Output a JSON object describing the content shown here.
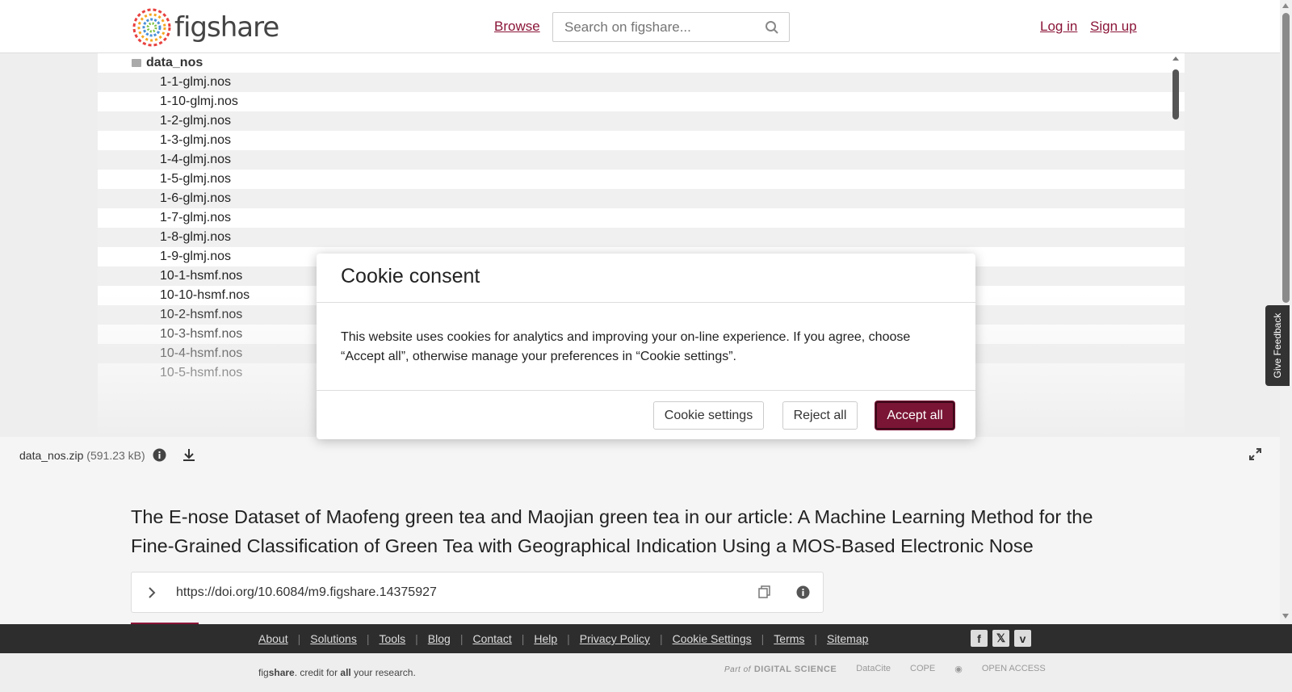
{
  "header": {
    "logo_text": "figshare",
    "browse_label": "Browse",
    "search_placeholder": "Search on figshare...",
    "login_label": "Log in",
    "signup_label": "Sign up"
  },
  "file_tree": {
    "root": "data_nos",
    "files": [
      "1-1-glmj.nos",
      "1-10-glmj.nos",
      "1-2-glmj.nos",
      "1-3-glmj.nos",
      "1-4-glmj.nos",
      "1-5-glmj.nos",
      "1-6-glmj.nos",
      "1-7-glmj.nos",
      "1-8-glmj.nos",
      "1-9-glmj.nos",
      "10-1-hsmf.nos",
      "10-10-hsmf.nos",
      "10-2-hsmf.nos",
      "10-3-hsmf.nos",
      "10-4-hsmf.nos",
      "10-5-hsmf.nos"
    ]
  },
  "file_bar": {
    "file_name": "data_nos.zip",
    "file_size": "(591.23 kB)"
  },
  "item": {
    "title": "The E-nose Dataset of Maofeng green tea and Maojian green tea in our article: A Machine Learning Method for the Fine-Grained Classification of Green Tea with Geographical Indication Using a MOS-Based Electronic Nose",
    "doi": "https://doi.org/10.6084/m9.figshare.14375927"
  },
  "feedback_label": "Give Feedback",
  "cookie_modal": {
    "title": "Cookie consent",
    "body": "This website uses cookies for analytics and improving your on-line experience. If you agree, choose “Accept all”, otherwise manage your preferences in “Cookie settings”.",
    "settings_label": "Cookie settings",
    "reject_label": "Reject all",
    "accept_label": "Accept all"
  },
  "footer": {
    "links": [
      "About",
      "Solutions",
      "Tools",
      "Blog",
      "Contact",
      "Help",
      "Privacy Policy",
      "Cookie Settings",
      "Terms",
      "Sitemap"
    ],
    "social_icons": [
      "facebook-icon",
      "x-icon",
      "vimeo-icon"
    ],
    "tagline_fig": "fig",
    "tagline_share": "share",
    "tagline_mid": ". credit for ",
    "tagline_all": "all",
    "tagline_end": " your research.",
    "partners": {
      "part_of": "Part of",
      "digital_science": "DIGITAL SCIENCE",
      "datacite": "DataCite",
      "cope": "COPE",
      "open_access": "OPEN ACCESS"
    }
  },
  "colors": {
    "brand": "#8a1538",
    "accept_button": "#7a1535",
    "footer_dark": "#2d2d2d"
  }
}
